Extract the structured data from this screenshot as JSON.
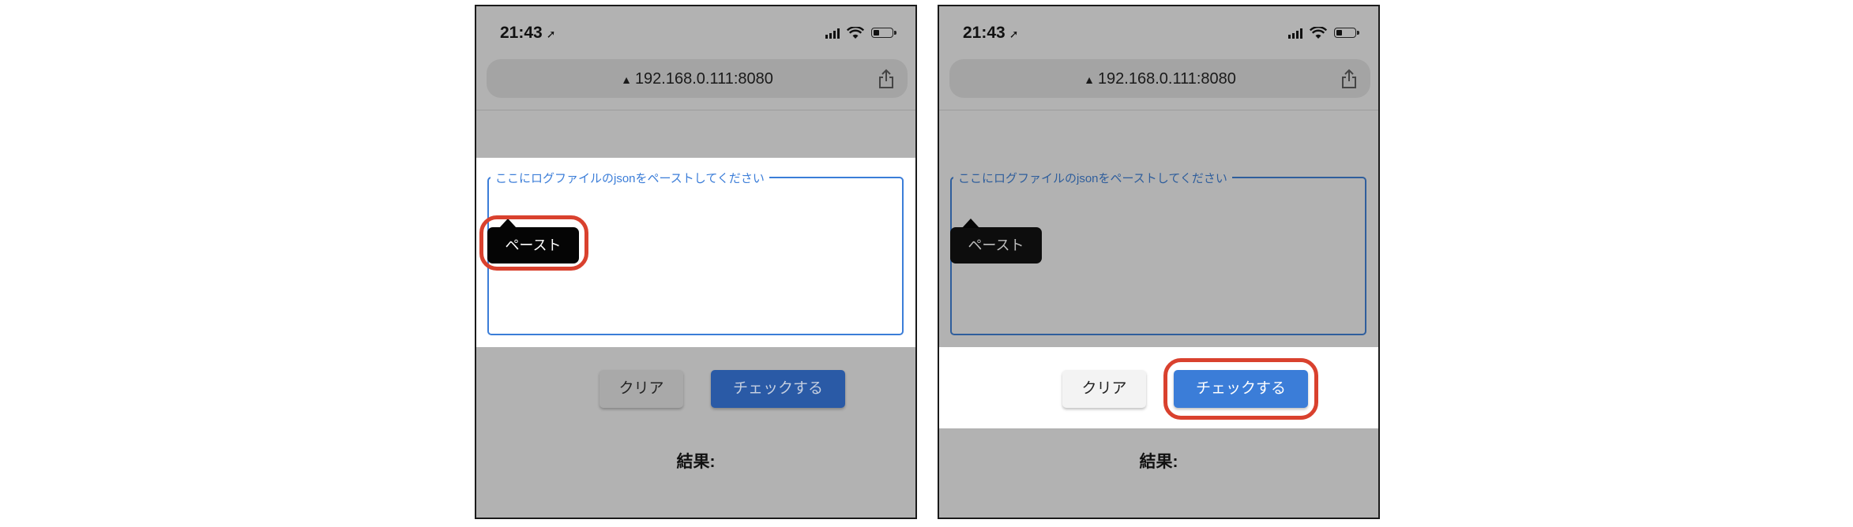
{
  "screens": [
    {
      "status": {
        "time": "21:43",
        "location_icon": "location-arrow-icon"
      },
      "url_bar": {
        "warning_icon": "warning-triangle-icon",
        "url": "192.168.0.111:8080",
        "share_icon": "share-icon"
      },
      "textarea": {
        "label": "ここにログファイルのjsonをペーストしてください",
        "value": ""
      },
      "paste_popup": {
        "label": "ペースト"
      },
      "buttons": {
        "clear": "クリア",
        "check": "チェックする"
      },
      "result_label": "結果:",
      "highlighted": "paste-popup"
    },
    {
      "status": {
        "time": "21:43",
        "location_icon": "location-arrow-icon"
      },
      "url_bar": {
        "warning_icon": "warning-triangle-icon",
        "url": "192.168.0.111:8080",
        "share_icon": "share-icon"
      },
      "textarea": {
        "label": "ここにログファイルのjsonをペーストしてください",
        "value": ""
      },
      "paste_popup": {
        "label": "ペースト"
      },
      "buttons": {
        "clear": "クリア",
        "check": "チェックする"
      },
      "result_label": "結果:",
      "highlighted": "check-button"
    }
  ],
  "colors": {
    "accent": "#3b7dd8",
    "highlight": "#d9412e",
    "overlay": "#b2b2b2"
  }
}
